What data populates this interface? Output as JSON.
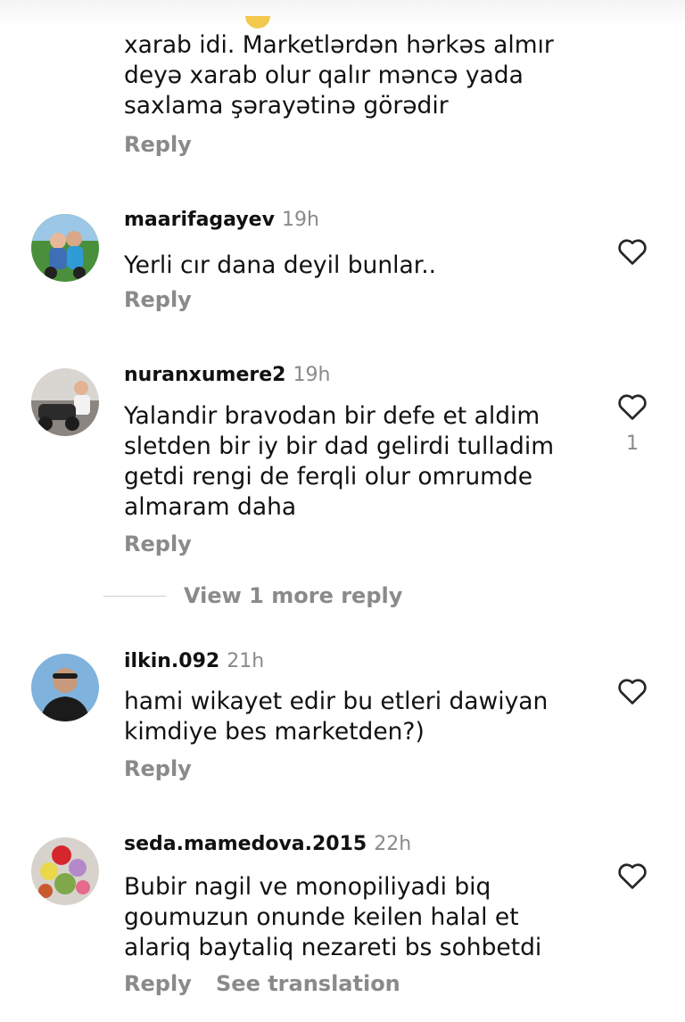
{
  "colors": {
    "text": "#111111",
    "muted": "#8a8a8a",
    "background": "#ffffff",
    "divider": "#cfcfcf"
  },
  "icons": {
    "like": "heart-outline-icon",
    "partial_emoji": "emoji-icon"
  },
  "top_comment": {
    "text": "xarab idi. Marketlərdən hərkəs almır\ndeyə xarab olur qalır məncə yada\nsaxlama şərayətinə görədir",
    "reply_label": "Reply"
  },
  "comments": [
    {
      "username": "maarifagayev",
      "time": "19h",
      "text": "Yerli cır dana deyil bunlar..",
      "reply_label": "Reply"
    },
    {
      "username": "nuranxumere2",
      "time": "19h",
      "text": "Yalandir bravodan bir defe et aldim\nsletden bir iy bir dad gelirdi tulladim\ngetdi rengi de ferqli olur omrumde\nalmaram daha",
      "reply_label": "Reply",
      "likes": "1",
      "view_more_label": "View 1 more reply"
    },
    {
      "username": "ilkin.092",
      "time": "21h",
      "text": "hami wikayet edir bu etleri dawiyan\nkimdiye bes marketden?)",
      "reply_label": "Reply"
    },
    {
      "username": "seda.mamedova.2015",
      "time": "22h",
      "text": "Bubir nagil ve monopiliyadi biq\ngoumuzun onunde keilen halal et\nalariq baytaliq nezareti bs sohbetdi",
      "reply_label": "Reply",
      "see_translation_label": "See translation"
    }
  ]
}
